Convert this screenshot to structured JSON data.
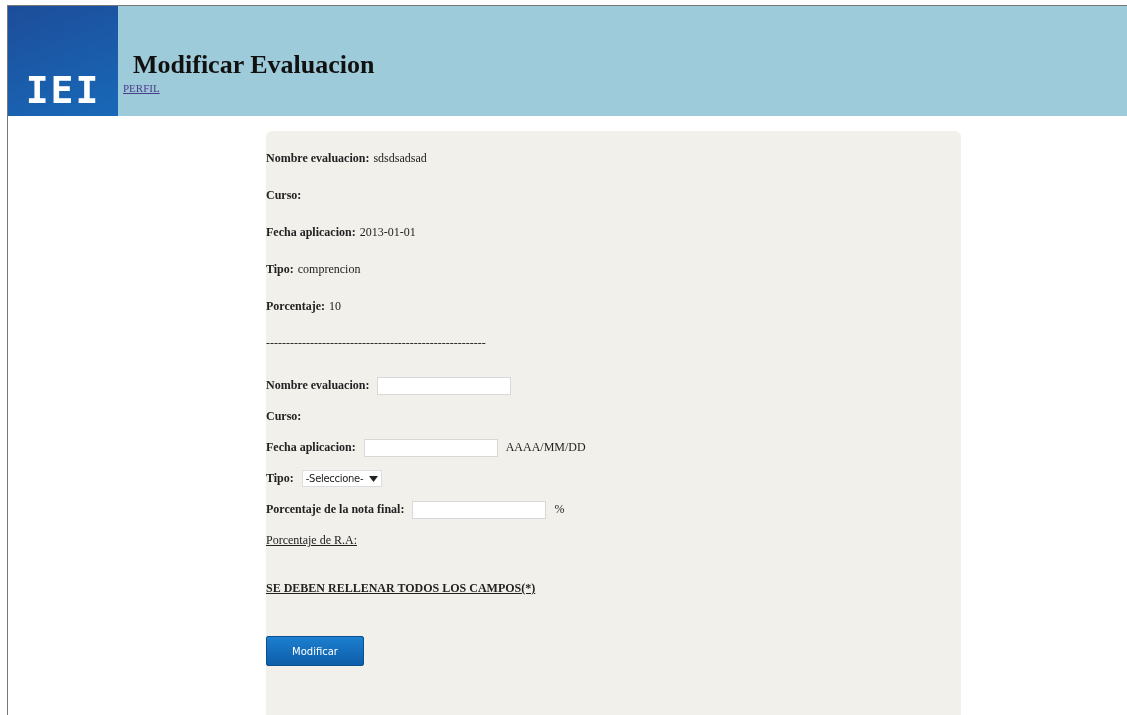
{
  "header": {
    "logo": "IEI",
    "title": "Modificar Evaluacion",
    "link": "PERFIL"
  },
  "details": [
    {
      "label": "Nombre evaluacion:",
      "value": "sdsdsadsad"
    },
    {
      "label": "Curso:"
    },
    {
      "label": "Fecha aplicacion:",
      "value": "2013-01-01"
    },
    {
      "label": "Tipo:",
      "value": "comprencion"
    },
    {
      "label": "Porcentaje:",
      "value": "10"
    }
  ],
  "separator": "-------------------------------------------------------",
  "form": [
    {
      "kind": "input",
      "label": "Nombre evaluacion:"
    },
    {
      "kind": "label",
      "label": "Curso:"
    },
    {
      "kind": "input",
      "label": "Fecha aplicacion:",
      "suffix": "AAAA/MM/DD"
    },
    {
      "kind": "select",
      "label": "Tipo:",
      "value": "-Seleccione-"
    },
    {
      "kind": "input",
      "label": "Porcentaje de la nota final:",
      "suffix": "%"
    },
    {
      "kind": "link",
      "label": "Porcentaje de R.A:"
    }
  ],
  "notice": "SE DEBEN RELLENAR TODOS LOS CAMPOS(*)",
  "submit": "Modificar"
}
